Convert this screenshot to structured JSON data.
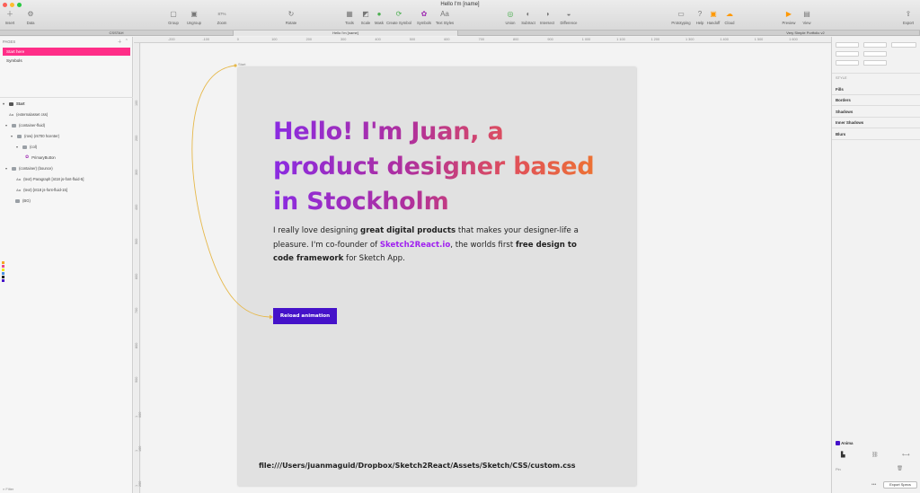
{
  "window": {
    "title": "Hello I'm [name]"
  },
  "toolbar": {
    "left": [
      {
        "label": "Insert",
        "icon": "plus-icon"
      },
      {
        "label": "Data",
        "icon": "data-icon"
      }
    ],
    "center_left": [
      {
        "label": "Group",
        "icon": "group-icon"
      },
      {
        "label": "Ungroup",
        "icon": "ungroup-icon"
      },
      {
        "label": "Zoom",
        "icon": "zoom-icon"
      },
      {
        "label": "Rotate",
        "icon": "rotate-icon"
      }
    ],
    "zoom_value": "87%",
    "center": [
      {
        "label": "Tools",
        "icon": "tools-icon"
      },
      {
        "label": "Scale",
        "icon": "scale-icon"
      },
      {
        "label": "Mask",
        "icon": "mask-icon"
      },
      {
        "label": "Create Symbol",
        "icon": "symbol-icon"
      },
      {
        "label": "Symbols",
        "icon": "symbols-icon"
      },
      {
        "label": "Text Styles",
        "icon": "text-styles-icon"
      }
    ],
    "boolean": [
      {
        "label": "Union",
        "icon": "union-icon"
      },
      {
        "label": "Subtract",
        "icon": "subtract-icon"
      },
      {
        "label": "Intersect",
        "icon": "intersect-icon"
      },
      {
        "label": "Difference",
        "icon": "difference-icon"
      }
    ],
    "right_group": [
      {
        "label": "Prototyping",
        "icon": "prototyping-icon"
      },
      {
        "label": "Help",
        "icon": "help-icon"
      },
      {
        "label": "Handoff",
        "icon": "handoff-icon"
      },
      {
        "label": "Cloud",
        "icon": "cloud-icon"
      }
    ],
    "far_right": [
      {
        "label": "Preview",
        "icon": "preview-icon"
      },
      {
        "label": "View",
        "icon": "view-icon"
      },
      {
        "label": "Export",
        "icon": "export-icon"
      }
    ]
  },
  "tabs": [
    {
      "label": "CSSTAH"
    },
    {
      "label": "Hello I'm [name]"
    },
    {
      "label": "Very Simple Portfolio v2"
    }
  ],
  "left_panel": {
    "pages_header": "PAGES",
    "pages": [
      "Start here",
      "Symbols"
    ],
    "layers": [
      {
        "label": "Start",
        "type": "artboard"
      },
      {
        "label": "(externalasset css)",
        "type": "text"
      },
      {
        "label": "(container-fluid)",
        "type": "folder"
      },
      {
        "label": "(row) (nt700 hcenter)",
        "type": "folder"
      },
      {
        "label": "(col)",
        "type": "folder"
      },
      {
        "label": "PrimaryButton",
        "type": "symbol"
      },
      {
        "label": "(container) (bounce)",
        "type": "folder"
      },
      {
        "label": "(text) Paragraph [nt18 js-font-fluid-5]",
        "type": "text"
      },
      {
        "label": "(text) [nt18 js-font-fluid-15]",
        "type": "text"
      },
      {
        "label": "(BG)",
        "type": "folder"
      }
    ],
    "filter_label": "Filter"
  },
  "ruler": {
    "h_ticks": [
      "-200",
      "-100",
      "0",
      "100",
      "200",
      "300",
      "400",
      "500",
      "600",
      "700",
      "800",
      "900",
      "1 000",
      "1 100",
      "1 200",
      "1 300",
      "1 400",
      "1 500",
      "1 600"
    ],
    "v_ticks": [
      "100",
      "200",
      "300",
      "400",
      "500",
      "600",
      "700",
      "800",
      "900",
      "1 000",
      "1 100",
      "1 200"
    ]
  },
  "artboard": {
    "name": "Start",
    "headline": "Hello! I'm Juan, a product designer based in Stockholm",
    "intro": {
      "p1": "I really love designing ",
      "b1": "great digital products",
      "p2": " that makes your designer-life a pleasure. I'm co-founder of ",
      "brand": "Sketch2React.io",
      "p3": ", the worlds first ",
      "b2": "free design to code framework",
      "p4": " for Sketch App."
    },
    "button_label": "Reload animation",
    "file_path": "file:///Users/juanmaguid/Dropbox/Sketch2React/Assets/Sketch/CSS/custom.css"
  },
  "inspector": {
    "style_label": "STYLE",
    "sections": [
      "Fills",
      "Borders",
      "Shadows",
      "Inner Shadows",
      "Blurs"
    ],
    "anima_label": "Anima",
    "pin_label": "Pin",
    "export_label": "Export Specs"
  },
  "colors": {
    "page_active": "#ff2e88",
    "button": "#4512c9",
    "brand_link": "#a020f0",
    "flow_line": "#e6b84a"
  }
}
